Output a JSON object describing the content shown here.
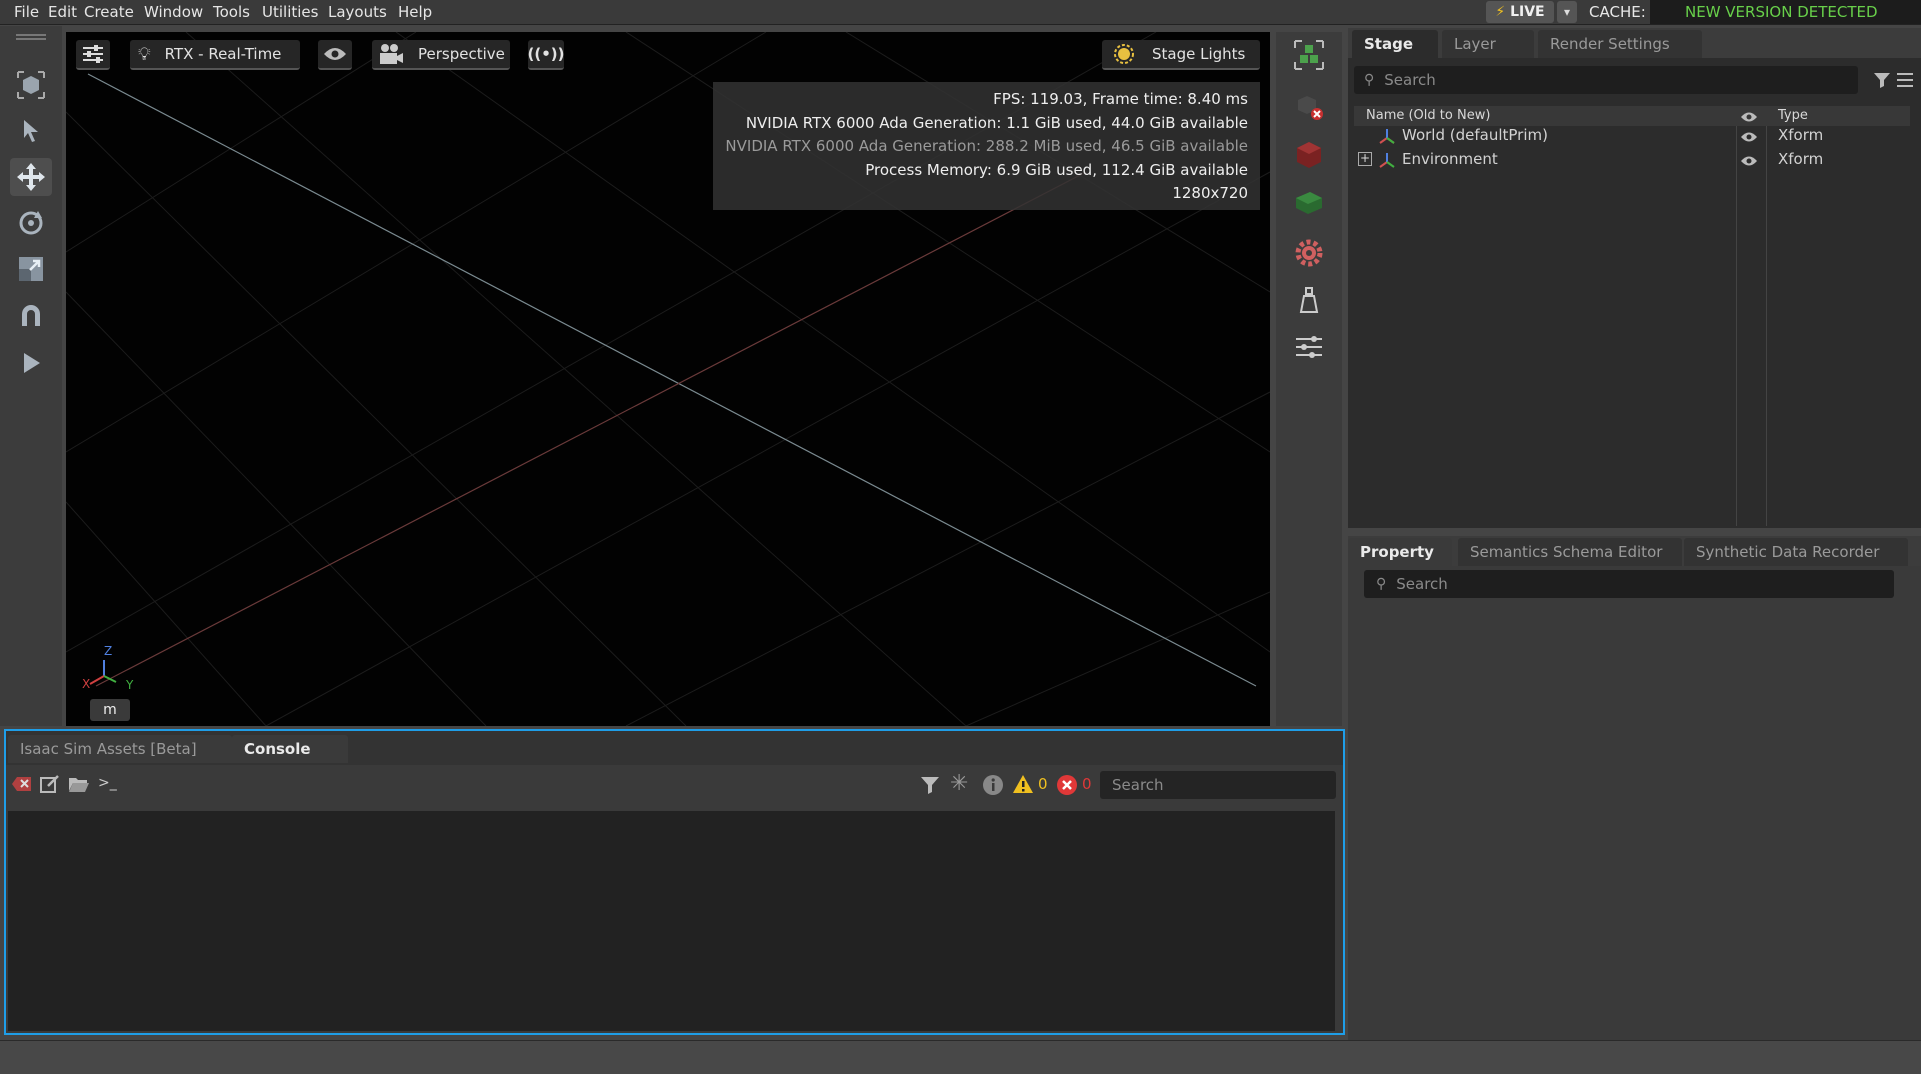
{
  "menu": {
    "items": [
      "File",
      "Edit",
      "Create",
      "Window",
      "Tools",
      "Utilities",
      "Layouts",
      "Help"
    ],
    "live_label": "LIVE",
    "cache_label": "CACHE:",
    "cache_status": "NEW VERSION DETECTED"
  },
  "viewport": {
    "render_mode": "RTX - Real-Time",
    "camera": "Perspective",
    "lights": "Stage Lights",
    "unit_label": "m",
    "axis_x": "X",
    "axis_y": "Y",
    "axis_z": "Z",
    "stats": {
      "fps": "FPS: 119.03, Frame time: 8.40 ms",
      "gpu1": "NVIDIA RTX 6000 Ada Generation: 1.1 GiB used, 44.0 GiB available",
      "gpu2": "NVIDIA RTX 6000 Ada Generation: 288.2 MiB used, 46.5 GiB available",
      "process": "Process Memory: 6.9 GiB used, 112.4 GiB available",
      "resolution": "1280x720"
    }
  },
  "stage": {
    "tabs": [
      "Stage",
      "Layer",
      "Render Settings"
    ],
    "search_placeholder": "Search",
    "col_name": "Name (Old to New)",
    "col_type": "Type",
    "rows": [
      {
        "name": "World (defaultPrim)",
        "type": "Xform"
      },
      {
        "name": "Environment",
        "type": "Xform"
      }
    ]
  },
  "property": {
    "tabs": [
      "Property",
      "Semantics Schema Editor",
      "Synthetic Data Recorder"
    ],
    "search_placeholder": "Search"
  },
  "console": {
    "tabs": [
      "Isaac Sim Assets [Beta]",
      "Console"
    ],
    "prompt": ">_",
    "warnings": "0",
    "errors": "0",
    "search_placeholder": "Search"
  },
  "colors": {
    "accent": "#1f9ee8",
    "cache_ok": "#68d04a",
    "warning": "#f0c020",
    "error": "#e03838"
  }
}
